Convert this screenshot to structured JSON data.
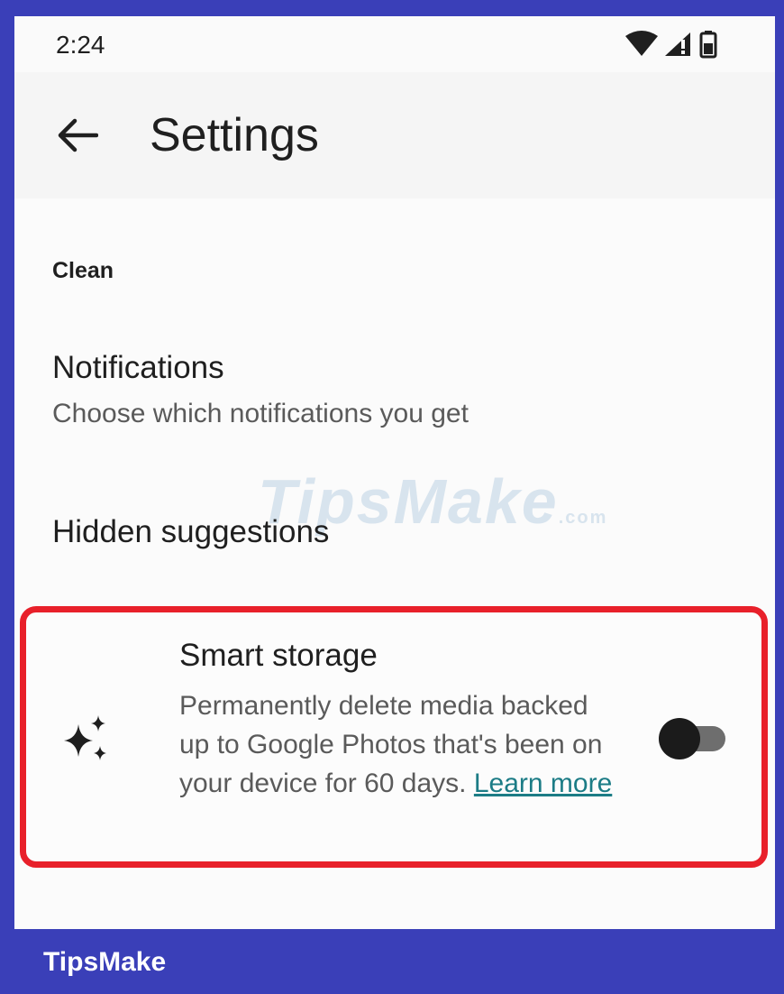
{
  "status_bar": {
    "time": "2:24",
    "icons": [
      "wifi-icon",
      "signal-icon",
      "battery-icon"
    ]
  },
  "app_bar": {
    "back_icon": "arrow-back-icon",
    "title": "Settings"
  },
  "settings": {
    "section_header": "Clean",
    "notifications": {
      "title": "Notifications",
      "subtitle": "Choose which notifications you get"
    },
    "hidden_suggestions": {
      "title": "Hidden suggestions"
    },
    "smart_storage": {
      "icon": "sparkle-icon",
      "title": "Smart storage",
      "description": "Permanently delete media backed up to Google Photos that's been on your device for 60 days.",
      "link": "Learn more",
      "toggle_state": "off"
    }
  },
  "watermark": {
    "text": "TipsMake",
    "suffix": ".com"
  },
  "footer": {
    "brand": "TipsMake"
  },
  "colors": {
    "frame": "#3a3fb8",
    "highlight_border": "#e8202a",
    "link": "#1c7c86",
    "toggle_thumb": "#1b1b1b",
    "toggle_track": "#6e6e6e"
  }
}
